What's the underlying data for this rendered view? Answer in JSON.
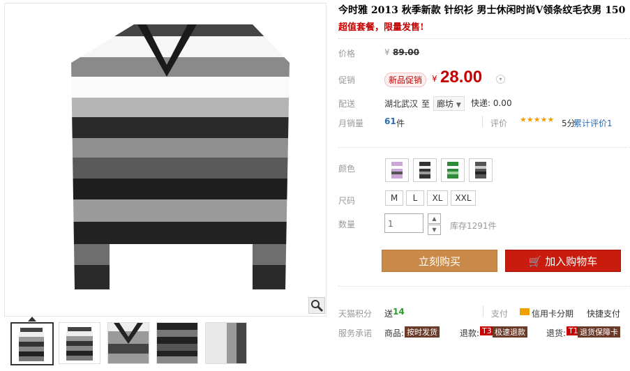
{
  "title": "今时雅 2013 秋季新款 针织衫 男士休闲时尚V领条纹毛衣男 150",
  "subtitle": "超值套餐，限量发售!",
  "price": {
    "label": "价格",
    "currency": "¥",
    "value": "89.00"
  },
  "promo": {
    "label": "促销",
    "tag": "新品促销",
    "currency": "¥",
    "value": "28.00"
  },
  "delivery": {
    "label": "配送",
    "from": "湖北武汉",
    "to": "至",
    "region": "廊坊",
    "express": "快递: 0.00"
  },
  "sales": {
    "label": "月销量",
    "count": "61",
    "unit": "件",
    "review_label": "评价",
    "stars": "★★★★★",
    "score": "5分",
    "review_text": "累计评价1"
  },
  "color": {
    "label": "颜色"
  },
  "size": {
    "label": "尺码",
    "options": [
      "M",
      "L",
      "XL",
      "XXL"
    ]
  },
  "quantity": {
    "label": "数量",
    "value": "1",
    "stock": "库存1291件"
  },
  "buttons": {
    "buy": "立刻购买",
    "cart": "加入购物车"
  },
  "points": {
    "label": "天猫积分",
    "prefix": "送",
    "value": "14",
    "pay_label": "支付",
    "credit": "信用卡分期",
    "fast_pay": "快捷支付"
  },
  "service": {
    "label": "服务承诺",
    "item1_label": "商品:",
    "item1_badge": "按时发货",
    "item2_label": "退款:",
    "item2_code": "T3",
    "item2_badge": "极速退款",
    "item3_label": "退货:",
    "item3_code": "T1",
    "item3_badge": "退货保障卡"
  },
  "colors": {
    "accent": "#c40000",
    "buy": "#c98a49",
    "cart": "#c91c0e",
    "green": "#2b9b2b"
  }
}
